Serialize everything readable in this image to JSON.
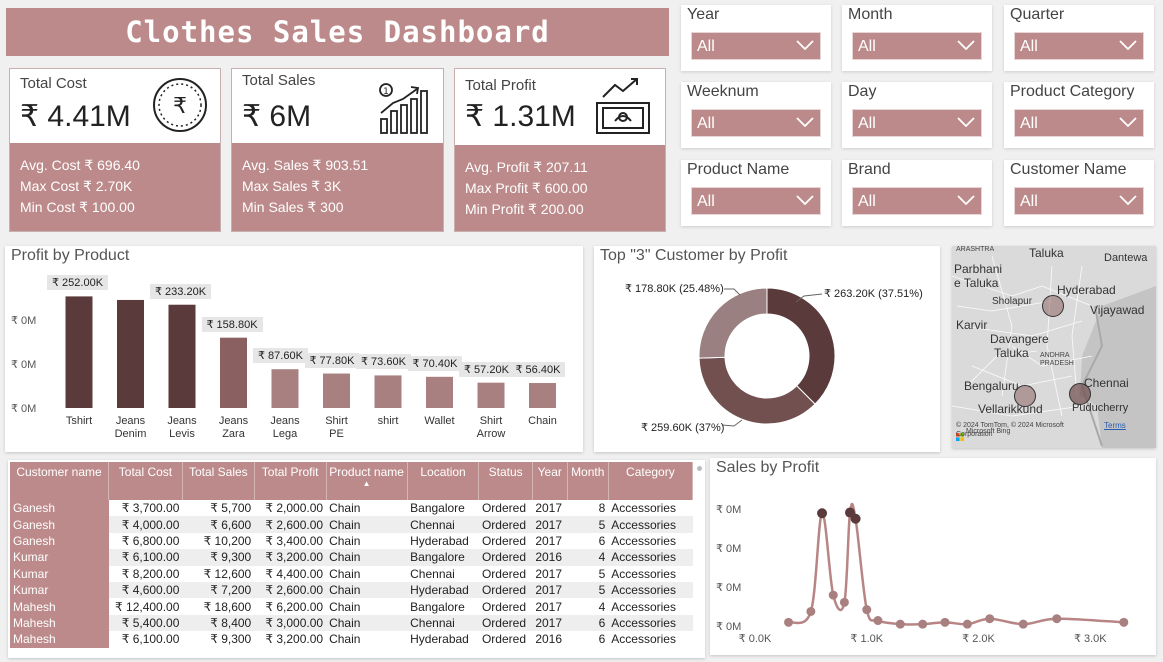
{
  "title": "Clothes Sales Dashboard",
  "kpis": [
    {
      "label": "Total Cost",
      "value": "₹ 4.41M",
      "line1": "Avg. Cost ₹ 696.40",
      "line2": "Max Cost ₹ 2.70K",
      "line3": "Min Cost ₹ 100.00",
      "icon": "rupee-coin-icon"
    },
    {
      "label": "Total Sales",
      "value": "₹ 6M",
      "line1": "Avg. Sales ₹ 903.51",
      "line2": "Max Sales ₹ 3K",
      "line3": "Min Sales ₹ 300",
      "icon": "growth-bars-icon"
    },
    {
      "label": "Total Profit",
      "value": "₹ 1.31M",
      "line1": "Avg. Profit ₹ 207.11",
      "line2": "Max Profit ₹ 600.00",
      "line3": "Min Profit ₹ 200.00",
      "icon": "money-growth-icon"
    }
  ],
  "slicers": [
    {
      "label": "Year",
      "value": "All"
    },
    {
      "label": "Month",
      "value": "All"
    },
    {
      "label": "Quarter",
      "value": "All"
    },
    {
      "label": "Weeknum",
      "value": "All"
    },
    {
      "label": "Day",
      "value": "All"
    },
    {
      "label": "Product Category",
      "value": "All"
    },
    {
      "label": "Product Name",
      "value": "All"
    },
    {
      "label": "Brand",
      "value": "All"
    },
    {
      "label": "Customer Name",
      "value": "All"
    }
  ],
  "profit_by_product": {
    "title": "Profit by Product",
    "y_ticks": [
      "₹ 0M",
      "₹ 0M",
      "₹ 0M"
    ]
  },
  "top_customers": {
    "title": "Top \"3\" Customer by Profit",
    "labels": [
      "₹ 263.20K (37.51%)",
      "₹ 259.60K (37%)",
      "₹ 178.80K (25.48%)"
    ]
  },
  "map": {
    "places": [
      "Taluka",
      "Dantewa",
      "Parbhani",
      "e Taluka",
      "Hyderabad",
      "Sholapur",
      "Vijayawad",
      "Karvir",
      "Davangere",
      "Taluka",
      "ANDHRA",
      "PRADESH",
      "Bengaluru",
      "Chennai",
      "Vellarikkund",
      "Puducherry",
      "ARASHTRA"
    ],
    "attribution": "© 2024 TomTom, © 2024 Microsoft Corporation",
    "terms": "Terms",
    "logo": "Microsoft Bing"
  },
  "table": {
    "headers": [
      "Customer name",
      "Total Cost",
      "Total Sales",
      "Total Profit",
      "Product name",
      "Location",
      "Status",
      "Year",
      "Month",
      "Category"
    ],
    "rows": [
      [
        "Ganesh",
        "₹ 3,700.00",
        "₹ 5,700",
        "₹ 2,000.00",
        "Chain",
        "Bangalore",
        "Ordered",
        "2017",
        "8",
        "Accessories"
      ],
      [
        "Ganesh",
        "₹ 4,000.00",
        "₹ 6,600",
        "₹ 2,600.00",
        "Chain",
        "Chennai",
        "Ordered",
        "2017",
        "5",
        "Accessories"
      ],
      [
        "Ganesh",
        "₹ 6,800.00",
        "₹ 10,200",
        "₹ 3,400.00",
        "Chain",
        "Hyderabad",
        "Ordered",
        "2017",
        "6",
        "Accessories"
      ],
      [
        "Kumar",
        "₹ 6,100.00",
        "₹ 9,300",
        "₹ 3,200.00",
        "Chain",
        "Bangalore",
        "Ordered",
        "2016",
        "4",
        "Accessories"
      ],
      [
        "Kumar",
        "₹ 8,200.00",
        "₹ 12,600",
        "₹ 4,400.00",
        "Chain",
        "Chennai",
        "Ordered",
        "2017",
        "5",
        "Accessories"
      ],
      [
        "Kumar",
        "₹ 4,600.00",
        "₹ 7,200",
        "₹ 2,600.00",
        "Chain",
        "Hyderabad",
        "Ordered",
        "2017",
        "5",
        "Accessories"
      ],
      [
        "Mahesh",
        "₹ 12,400.00",
        "₹ 18,600",
        "₹ 6,200.00",
        "Chain",
        "Bangalore",
        "Ordered",
        "2017",
        "4",
        "Accessories"
      ],
      [
        "Mahesh",
        "₹ 5,400.00",
        "₹ 8,400",
        "₹ 3,000.00",
        "Chain",
        "Chennai",
        "Ordered",
        "2017",
        "6",
        "Accessories"
      ],
      [
        "Mahesh",
        "₹ 6,100.00",
        "₹ 9,300",
        "₹ 3,200.00",
        "Chain",
        "Hyderabad",
        "Ordered",
        "2016",
        "6",
        "Accessories"
      ]
    ]
  },
  "sales_by_profit": {
    "title": "Sales by Profit",
    "y_ticks": [
      "₹ 0M",
      "₹ 0M",
      "₹ 0M",
      "₹ 0M"
    ]
  },
  "colors": {
    "accent": "#bc8a8a",
    "dark_bar": "#5a3a3a",
    "line": "#b88585"
  },
  "chart_data": [
    {
      "type": "bar",
      "title": "Profit by Product",
      "categories": [
        "Tshirt",
        "Jeans Denim",
        "Jeans Levis",
        "Jeans Zara",
        "Jeans Lega",
        "Shirt PE",
        "shirt",
        "Wallet",
        "Shirt Arrow",
        "Chain"
      ],
      "values": [
        252000,
        244000,
        233200,
        158800,
        87600,
        77800,
        73600,
        70400,
        57200,
        56400
      ],
      "data_labels": [
        "₹ 252.00K",
        "",
        "₹ 233.20K",
        "₹ 158.80K",
        "₹ 87.60K",
        "₹ 77.80K",
        "₹ 73.60K",
        "₹ 70.40K",
        "₹ 57.20K",
        "₹ 56.40K"
      ],
      "ylim": [
        0,
        280000
      ]
    },
    {
      "type": "pie",
      "title": "Top \"3\" Customer by Profit",
      "values": [
        263200,
        259600,
        178800
      ],
      "percent": [
        37.51,
        37,
        25.48
      ],
      "colors": [
        "#5a3a3a",
        "#725050",
        "#9a8080"
      ]
    },
    {
      "type": "line",
      "title": "Sales by Profit",
      "x": [
        300,
        500,
        600,
        700,
        800,
        850,
        900,
        1000,
        1100,
        1300,
        1500,
        1700,
        1900,
        2100,
        2400,
        2700,
        3300
      ],
      "y": [
        10000,
        40000,
        310000,
        85000,
        65000,
        312000,
        295000,
        45000,
        15000,
        5000,
        5000,
        10000,
        5000,
        20000,
        5000,
        20000,
        10000
      ],
      "x_ticks": [
        "₹ 0.0K",
        "₹ 1.0K",
        "₹ 2.0K",
        "₹ 3.0K"
      ],
      "xlim": [
        0,
        3400
      ],
      "ylim": [
        0,
        330000
      ]
    }
  ]
}
